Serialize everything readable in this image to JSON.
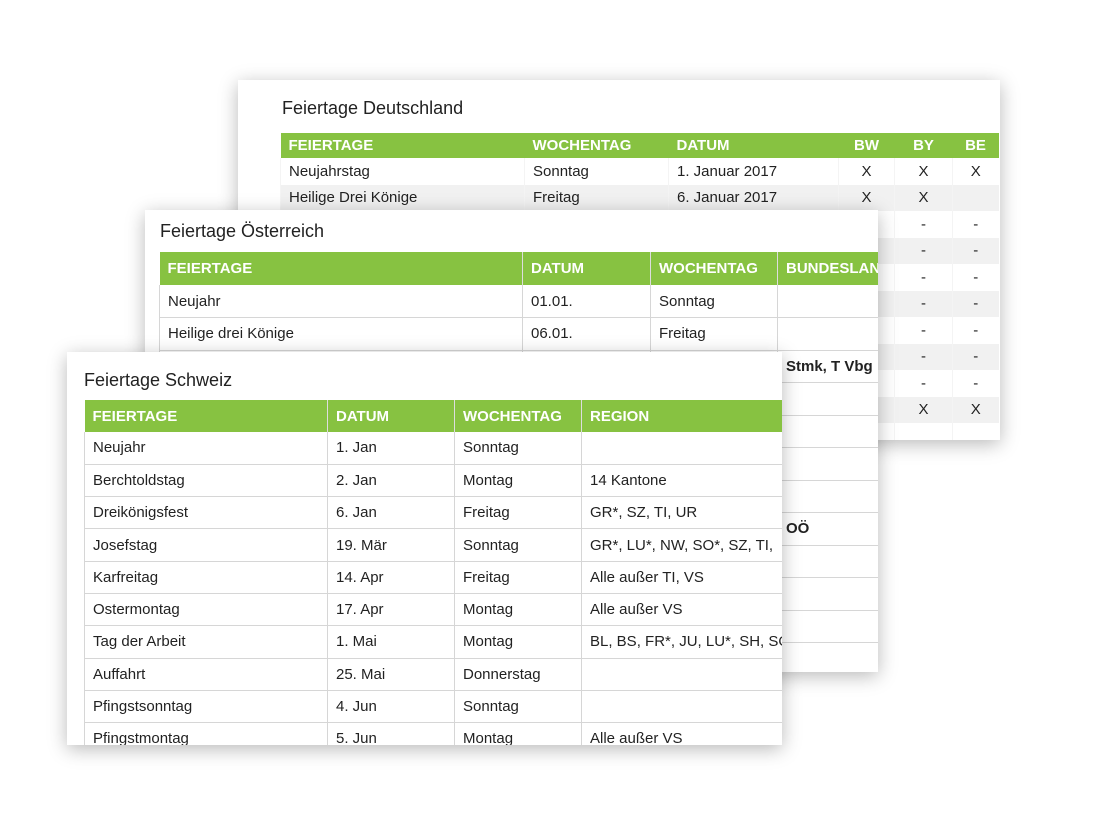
{
  "accent_color": "#87c241",
  "germany": {
    "title": "Feiertage Deutschland",
    "headers": [
      "FEIERTAGE",
      "WOCHENTAG",
      "DATUM",
      "BW",
      "BY",
      "BE"
    ],
    "rows": [
      [
        "Neujahrstag",
        "Sonntag",
        "1. Januar 2017",
        "X",
        "X",
        "X"
      ],
      [
        "Heilige Drei Könige",
        "Freitag",
        "6. Januar 2017",
        "X",
        "X",
        ""
      ],
      [
        "",
        "",
        "",
        "",
        "-",
        "-"
      ],
      [
        "",
        "",
        "",
        "",
        "-",
        "-"
      ],
      [
        "",
        "",
        "",
        "",
        "-",
        "-"
      ],
      [
        "",
        "",
        "",
        "",
        "-",
        "-"
      ],
      [
        "",
        "",
        "",
        "",
        "-",
        "-"
      ],
      [
        "",
        "",
        "",
        "",
        "-",
        "-"
      ],
      [
        "",
        "",
        "",
        "",
        "-",
        "-"
      ],
      [
        "",
        "",
        "",
        "",
        "X",
        "X"
      ],
      [
        "",
        "",
        "",
        "",
        "",
        ""
      ]
    ]
  },
  "austria": {
    "title": "Feiertage Österreich",
    "headers": [
      "FEIERTAGE",
      "DATUM",
      "WOCHENTAG",
      "BUNDESLAND"
    ],
    "rows": [
      [
        "Neujahr",
        "01.01.",
        "Sonntag",
        ""
      ],
      [
        "Heilige drei Könige",
        "06.01.",
        "Freitag",
        ""
      ],
      [
        "",
        "",
        "",
        "Stmk, T Vbg"
      ],
      [
        "",
        "",
        "",
        ""
      ],
      [
        "",
        "",
        "",
        ""
      ],
      [
        "",
        "",
        "",
        ""
      ],
      [
        "",
        "",
        "",
        ""
      ],
      [
        "",
        "",
        "",
        "OÖ"
      ],
      [
        "",
        "",
        "",
        ""
      ],
      [
        "",
        "",
        "",
        ""
      ],
      [
        "",
        "",
        "",
        ""
      ],
      [
        "",
        "",
        "",
        ""
      ]
    ]
  },
  "switzerland": {
    "title": "Feiertage Schweiz",
    "headers": [
      "FEIERTAGE",
      "DATUM",
      "WOCHENTAG",
      "REGION"
    ],
    "rows": [
      [
        "Neujahr",
        "1. Jan",
        "Sonntag",
        ""
      ],
      [
        "Berchtoldstag",
        "2. Jan",
        "Montag",
        "14 Kantone"
      ],
      [
        "Dreikönigsfest",
        "6. Jan",
        "Freitag",
        "GR*, SZ, TI, UR"
      ],
      [
        "Josefstag",
        "19. Mär",
        "Sonntag",
        "GR*, LU*, NW, SO*, SZ, TI,"
      ],
      [
        "Karfreitag",
        "14. Apr",
        "Freitag",
        "Alle außer TI, VS"
      ],
      [
        "Ostermontag",
        "17. Apr",
        "Montag",
        "Alle außer VS"
      ],
      [
        "Tag der Arbeit",
        "1. Mai",
        "Montag",
        "BL, BS, FR*, JU, LU*, SH, SO"
      ],
      [
        "Auffahrt",
        "25. Mai",
        "Donnerstag",
        ""
      ],
      [
        "Pfingstsonntag",
        "4. Jun",
        "Sonntag",
        ""
      ],
      [
        "Pfingstmontag",
        "5. Jun",
        "Montag",
        "Alle außer VS"
      ]
    ]
  }
}
